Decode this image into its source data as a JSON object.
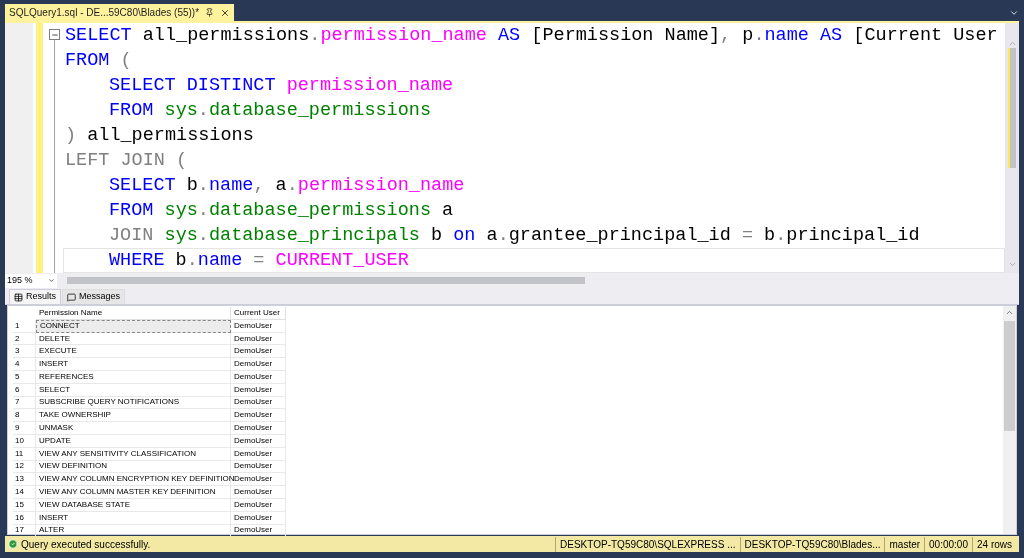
{
  "document_tab": {
    "title": "SQLQuery1.sql - DE...59C80\\Blades (55))*",
    "modified": true
  },
  "editor": {
    "lines": [
      {
        "indent": false,
        "current": false,
        "tokens": [
          {
            "kind": "keyword",
            "text": "SELECT"
          },
          {
            "kind": "plain",
            "text": " all_permissions"
          },
          {
            "kind": "operator",
            "text": "."
          },
          {
            "kind": "function",
            "text": "permission_name"
          },
          {
            "kind": "keyword",
            "text": " AS"
          },
          {
            "kind": "plain",
            "text": " [Permission Name]"
          },
          {
            "kind": "operator",
            "text": ","
          },
          {
            "kind": "plain",
            "text": " p"
          },
          {
            "kind": "operator",
            "text": "."
          },
          {
            "kind": "keyword",
            "text": "name AS"
          },
          {
            "kind": "plain",
            "text": " [Current User"
          }
        ]
      },
      {
        "indent": false,
        "current": false,
        "tokens": [
          {
            "kind": "keyword",
            "text": "FROM"
          },
          {
            "kind": "operator",
            "text": " ("
          }
        ]
      },
      {
        "indent": true,
        "current": false,
        "tokens": [
          {
            "kind": "keyword",
            "text": "SELECT DISTINCT"
          },
          {
            "kind": "function",
            "text": " permission_name"
          }
        ]
      },
      {
        "indent": true,
        "current": false,
        "tokens": [
          {
            "kind": "keyword",
            "text": "FROM"
          },
          {
            "kind": "system",
            "text": " sys"
          },
          {
            "kind": "operator",
            "text": "."
          },
          {
            "kind": "system",
            "text": "database_permissions"
          }
        ]
      },
      {
        "indent": false,
        "current": false,
        "tokens": [
          {
            "kind": "operator",
            "text": ")"
          },
          {
            "kind": "plain",
            "text": " all_permissions"
          }
        ]
      },
      {
        "indent": false,
        "current": false,
        "tokens": [
          {
            "kind": "operator",
            "text": "LEFT JOIN ("
          }
        ]
      },
      {
        "indent": true,
        "current": false,
        "tokens": [
          {
            "kind": "keyword",
            "text": "SELECT"
          },
          {
            "kind": "plain",
            "text": " b"
          },
          {
            "kind": "operator",
            "text": "."
          },
          {
            "kind": "keyword",
            "text": "name"
          },
          {
            "kind": "operator",
            "text": ","
          },
          {
            "kind": "plain",
            "text": " a"
          },
          {
            "kind": "operator",
            "text": "."
          },
          {
            "kind": "function",
            "text": "permission_name"
          }
        ]
      },
      {
        "indent": true,
        "current": false,
        "tokens": [
          {
            "kind": "keyword",
            "text": "FROM"
          },
          {
            "kind": "system",
            "text": " sys"
          },
          {
            "kind": "operator",
            "text": "."
          },
          {
            "kind": "system",
            "text": "database_permissions"
          },
          {
            "kind": "plain",
            "text": " a"
          }
        ]
      },
      {
        "indent": true,
        "current": false,
        "tokens": [
          {
            "kind": "operator",
            "text": "JOIN"
          },
          {
            "kind": "system",
            "text": " sys"
          },
          {
            "kind": "operator",
            "text": "."
          },
          {
            "kind": "system",
            "text": "database_principals"
          },
          {
            "kind": "plain",
            "text": " b"
          },
          {
            "kind": "keyword",
            "text": " on"
          },
          {
            "kind": "plain",
            "text": " a"
          },
          {
            "kind": "operator",
            "text": "."
          },
          {
            "kind": "plain",
            "text": "grantee_principal_id"
          },
          {
            "kind": "operator",
            "text": " ="
          },
          {
            "kind": "plain",
            "text": " b"
          },
          {
            "kind": "operator",
            "text": "."
          },
          {
            "kind": "plain",
            "text": "principal_id"
          }
        ]
      },
      {
        "indent": true,
        "current": true,
        "tokens": [
          {
            "kind": "keyword",
            "text": "WHERE"
          },
          {
            "kind": "plain",
            "text": " b"
          },
          {
            "kind": "operator",
            "text": "."
          },
          {
            "kind": "keyword",
            "text": "name"
          },
          {
            "kind": "operator",
            "text": " ="
          },
          {
            "kind": "function",
            "text": " CURRENT_USER"
          }
        ]
      }
    ]
  },
  "zoom": "195 %",
  "result_tabs": [
    {
      "label": "Results",
      "selected": true
    },
    {
      "label": "Messages",
      "selected": false
    }
  ],
  "grid": {
    "columns": [
      "Permission Name",
      "Current User"
    ],
    "rows": [
      {
        "number": "1",
        "cells": [
          "CONNECT",
          "DemoUser"
        ],
        "selected": true
      },
      {
        "number": "2",
        "cells": [
          "DELETE",
          "DemoUser"
        ],
        "selected": false
      },
      {
        "number": "3",
        "cells": [
          "EXECUTE",
          "DemoUser"
        ],
        "selected": false
      },
      {
        "number": "4",
        "cells": [
          "INSERT",
          "DemoUser"
        ],
        "selected": false
      },
      {
        "number": "5",
        "cells": [
          "REFERENCES",
          "DemoUser"
        ],
        "selected": false
      },
      {
        "number": "6",
        "cells": [
          "SELECT",
          "DemoUser"
        ],
        "selected": false
      },
      {
        "number": "7",
        "cells": [
          "SUBSCRIBE QUERY NOTIFICATIONS",
          "DemoUser"
        ],
        "selected": false
      },
      {
        "number": "8",
        "cells": [
          "TAKE OWNERSHIP",
          "DemoUser"
        ],
        "selected": false
      },
      {
        "number": "9",
        "cells": [
          "UNMASK",
          "DemoUser"
        ],
        "selected": false
      },
      {
        "number": "10",
        "cells": [
          "UPDATE",
          "DemoUser"
        ],
        "selected": false
      },
      {
        "number": "11",
        "cells": [
          "VIEW ANY SENSITIVITY CLASSIFICATION",
          "DemoUser"
        ],
        "selected": false
      },
      {
        "number": "12",
        "cells": [
          "VIEW DEFINITION",
          "DemoUser"
        ],
        "selected": false
      },
      {
        "number": "13",
        "cells": [
          "VIEW ANY COLUMN ENCRYPTION KEY DEFINITION",
          "DemoUser"
        ],
        "selected": false
      },
      {
        "number": "14",
        "cells": [
          "VIEW ANY COLUMN MASTER KEY DEFINITION",
          "DemoUser"
        ],
        "selected": false
      },
      {
        "number": "15",
        "cells": [
          "VIEW DATABASE STATE",
          "DemoUser"
        ],
        "selected": false
      },
      {
        "number": "16",
        "cells": [
          "INSERT",
          "DemoUser"
        ],
        "selected": false
      },
      {
        "number": "17",
        "cells": [
          "ALTER",
          "DemoUser"
        ],
        "selected": false
      }
    ]
  },
  "status_bar": {
    "message": "Query executed successfully.",
    "panels": [
      "DESKTOP-TQ59C80\\SQLEXPRESS ...",
      "DESKTOP-TQ59C80\\Blades...",
      "master",
      "00:00:00",
      "24 rows"
    ]
  }
}
